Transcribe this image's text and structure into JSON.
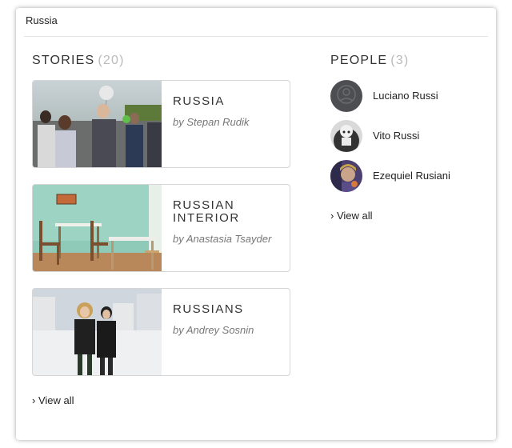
{
  "search": {
    "query": "Russia"
  },
  "stories": {
    "title": "STORIES",
    "count": "(20)",
    "items": [
      {
        "title": "RUSSIA",
        "author": "by Stepan Rudik"
      },
      {
        "title": "RUSSIAN INTERIOR",
        "author": "by Anastasia Tsayder"
      },
      {
        "title": "RUSSIANS",
        "author": "by Andrey Sosnin"
      }
    ],
    "view_all": "› View all"
  },
  "people": {
    "title": "PEOPLE",
    "count": "(3)",
    "items": [
      {
        "name": "Luciano Russi"
      },
      {
        "name": "Vito Russi"
      },
      {
        "name": "Ezequiel Rusiani"
      }
    ],
    "view_all": "› View all"
  },
  "colors": {
    "section_count": "#bbbbbb",
    "author_text": "#777777",
    "card_border": "#d6d6d6",
    "divider": "#e3e3e3"
  },
  "icons": {
    "default_avatar": "user-silhouette-icon"
  }
}
